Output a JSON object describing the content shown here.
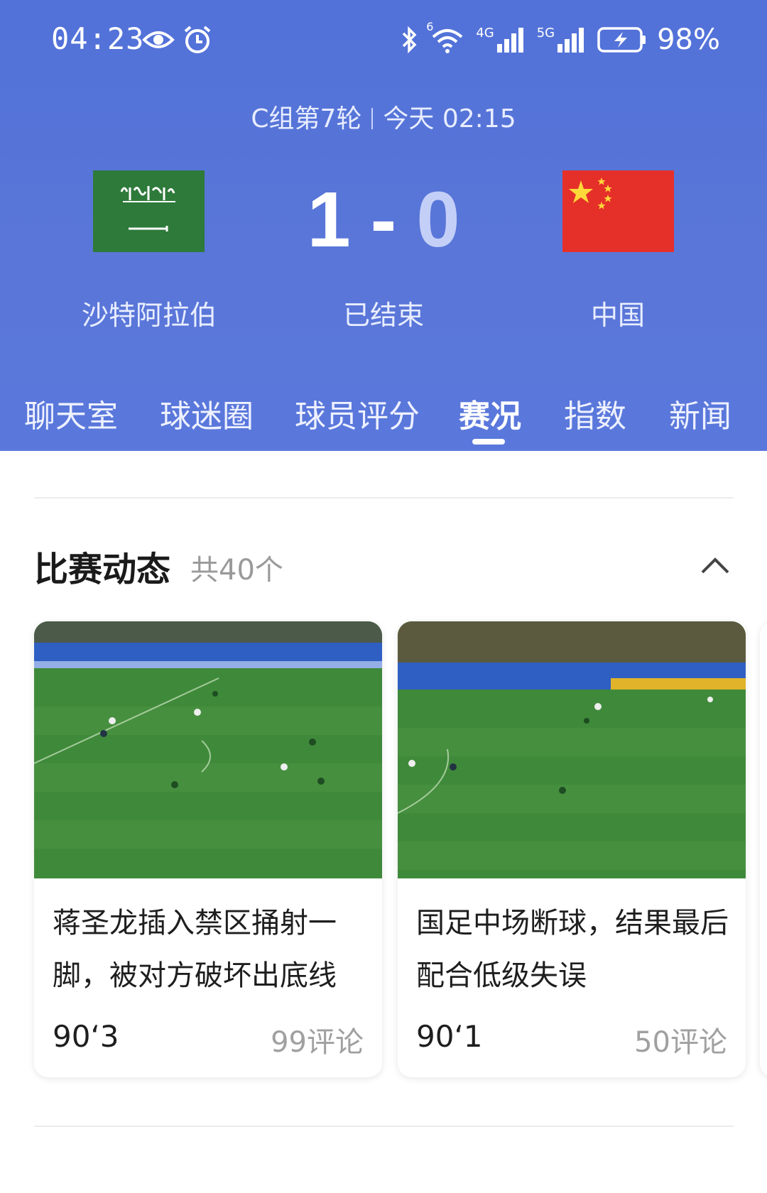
{
  "status_bar": {
    "time": "04:23",
    "battery": "98%",
    "network_1": "4G",
    "network_2": "5G",
    "wifi_badge": "6",
    "icons": [
      "eye-icon",
      "alarm-icon",
      "bluetooth-icon",
      "wifi-icon",
      "signal-4g-icon",
      "signal-5g-icon",
      "battery-charging-icon"
    ]
  },
  "match": {
    "round": "C组第7轮",
    "time": "今天 02:15",
    "home_team": "沙特阿拉伯",
    "away_team": "中国",
    "home_score": "1",
    "separator": "-",
    "away_score": "0",
    "status": "已结束",
    "home_flag_color": "#2e7a3a",
    "away_flag_color": "#e5302a"
  },
  "tabs": [
    {
      "label": "聊天室"
    },
    {
      "label": "球迷圈"
    },
    {
      "label": "球员评分"
    },
    {
      "label": "赛况",
      "active": true
    },
    {
      "label": "指数"
    },
    {
      "label": "新闻"
    }
  ],
  "section": {
    "title": "比赛动态",
    "count": "共40个"
  },
  "cards": [
    {
      "caption": "蒋圣龙插入禁区捅射一脚，被对方破坏出底线",
      "time": "90‘3",
      "comments": "99评论"
    },
    {
      "caption": "国足中场断球，结果最后配合低级失误",
      "time": "90‘1",
      "comments": "50评论"
    }
  ],
  "colors": {
    "header_bg": "#5470d8",
    "pitch_green": "#3f8a3a"
  }
}
